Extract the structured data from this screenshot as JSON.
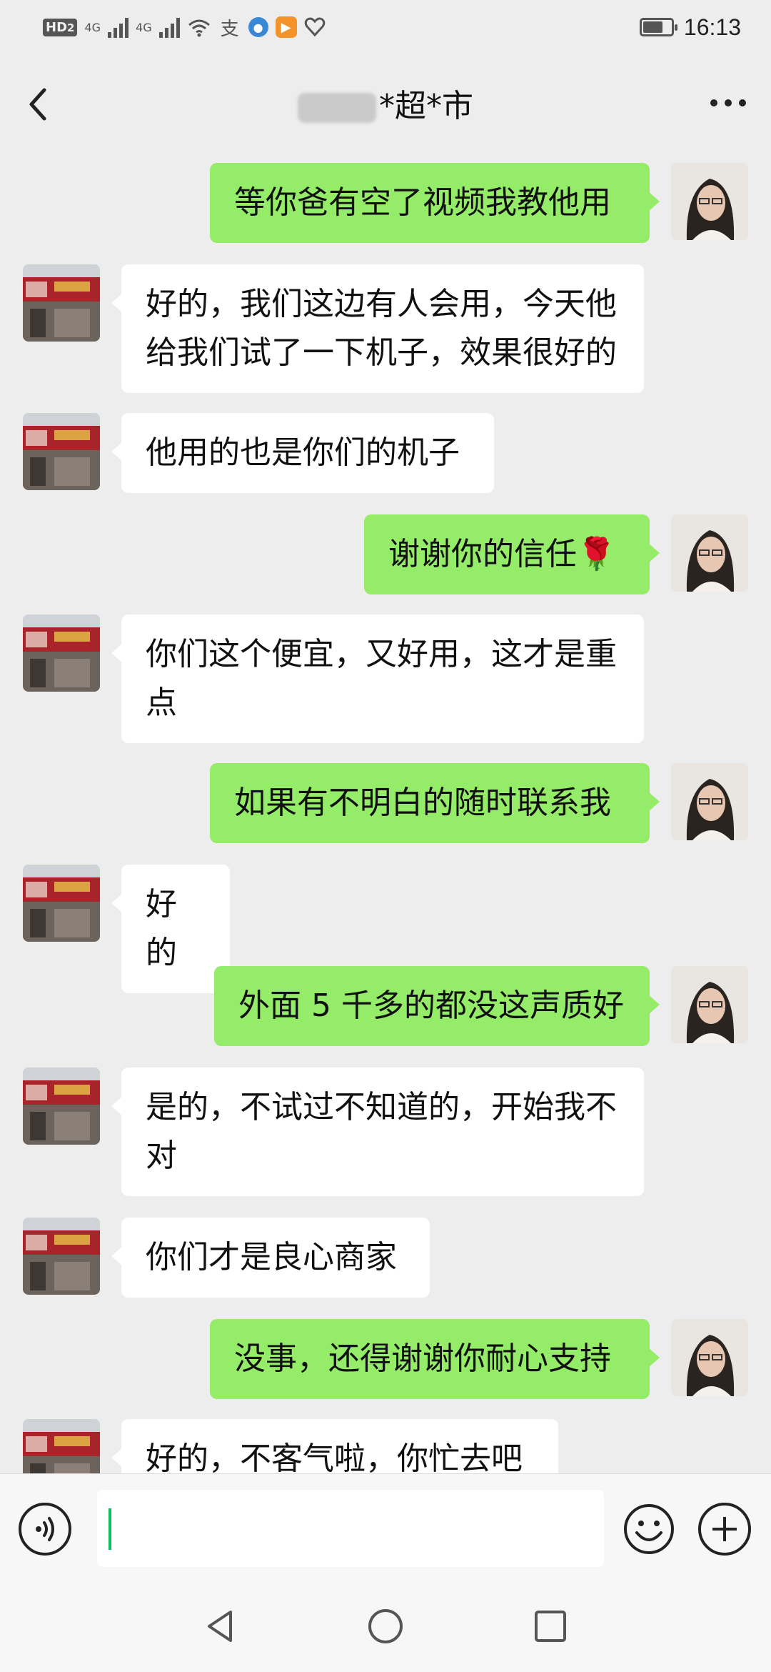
{
  "status_bar": {
    "hd": "HD",
    "hd_sub": "2",
    "net1": "4G",
    "net2": "4G",
    "alipay_glyph": "支",
    "time": "16:13",
    "battery_level": 0.7,
    "icons": [
      "hd-icon",
      "signal-icon",
      "signal-icon",
      "wifi-icon",
      "alipay-icon",
      "browser-icon",
      "video-icon",
      "heart-icon",
      "battery-icon"
    ]
  },
  "chat": {
    "title": "*超*市",
    "title_prefix_redacted": true,
    "back_icon": "chevron-left-icon",
    "more_icon": "more-dots-icon"
  },
  "messages": [
    {
      "from": "me",
      "text": "等你爸有空了视频我教他用"
    },
    {
      "from": "them",
      "text": "好的，我们这边有人会用，今天他给我们试了一下机子，效果很好的"
    },
    {
      "from": "them",
      "text": "他用的也是你们的机子"
    },
    {
      "from": "me",
      "text": "谢谢你的信任🌹"
    },
    {
      "from": "them",
      "text": "你们这个便宜，又好用，这才是重点"
    },
    {
      "from": "me",
      "text": "如果有不明白的随时联系我"
    },
    {
      "from": "them",
      "text": "好的"
    },
    {
      "from": "me",
      "text": "外面 5 千多的都没这声质好"
    },
    {
      "from": "them",
      "text": "是的，不试过不知道的，开始我不对"
    },
    {
      "from": "them",
      "text": "你们才是良心商家"
    },
    {
      "from": "me",
      "text": "没事，还得谢谢你耐心支持"
    },
    {
      "from": "them",
      "text": "好的，不客气啦，你忙去吧"
    }
  ],
  "input_bar": {
    "value": "",
    "voice_icon": "voice-icon",
    "emoji_icon": "emoji-icon",
    "plus_icon": "plus-icon"
  },
  "nav_bar": {
    "icons": [
      "back-triangle-icon",
      "home-circle-icon",
      "recents-square-icon"
    ]
  },
  "colors": {
    "background": "#ededed",
    "my_bubble": "#95ec69",
    "their_bubble": "#ffffff",
    "caret": "#07c160"
  }
}
